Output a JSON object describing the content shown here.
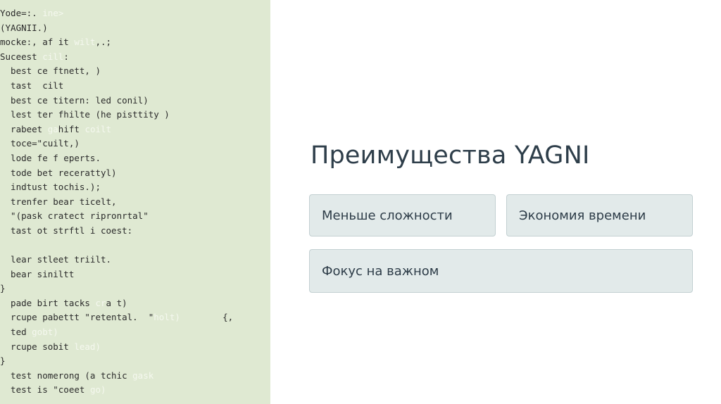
{
  "code_panel": {
    "lines": [
      {
        "text": "Yode=:. ",
        "faded": "ine>"
      },
      {
        "text": "(YAGNII.)",
        "faded": ""
      },
      {
        "text": "mocke:, af it ",
        "faded": "wilt",
        "tail": ",.;"
      },
      {
        "text": "Suceest ",
        "faded": "cill",
        "tail": ":"
      },
      {
        "text": "  best ce ftnett, )",
        "faded": ""
      },
      {
        "text": "  tast  cilt",
        "faded": ""
      },
      {
        "text": "  best ce titern: led conil)",
        "faded": ""
      },
      {
        "text": "  lest ter fhilte (he pisttity )",
        "faded": ""
      },
      {
        "text": "  rabeet ",
        "faded": "ga",
        "tail": "hift ",
        "faded2": "coilt"
      },
      {
        "text": "  toce=\"cuilt,)",
        "faded": ""
      },
      {
        "text": "  lode fe f eperts.",
        "faded": ""
      },
      {
        "text": "  tode bet recerattyl)",
        "faded": ""
      },
      {
        "text": "  indtust tochis.);",
        "faded": ""
      },
      {
        "text": "  trenfer bear ticelt,",
        "faded": ""
      },
      {
        "text": "  \"(pask cratect ripronrtal\"",
        "faded": ""
      },
      {
        "text": "  tast ot strftl i coest:",
        "faded": ""
      },
      {
        "text": "",
        "faded": ""
      },
      {
        "text": "  lear stleet triilt.",
        "faded": ""
      },
      {
        "text": "  bear siniltt",
        "faded": ""
      },
      {
        "text": "}",
        "faded": ""
      },
      {
        "text": "  pade birt tacks ",
        "faded": "cr",
        "tail": "a t)"
      },
      {
        "text": "  rcupe pabettt \"retental.  \"",
        "faded": "holt)",
        "tail": "        {,"
      },
      {
        "text": "  ted ",
        "faded": "gobt)"
      },
      {
        "text": "  rcupe sobit ",
        "faded": "lead)"
      },
      {
        "text": "}",
        "faded": ""
      },
      {
        "text": "  test nomerong (a tchic ",
        "faded": "gask"
      },
      {
        "text": "  test is \"coeet ",
        "faded": "go)"
      }
    ]
  },
  "title": "Преимущества YAGNI",
  "cards": [
    {
      "label": "Меньше сложности"
    },
    {
      "label": "Экономия времени"
    },
    {
      "label": "Фокус на важном"
    }
  ],
  "colors": {
    "code_background": "#dfe9d2",
    "card_background": "#e2eaea",
    "title_text": "#2e3e4a"
  }
}
